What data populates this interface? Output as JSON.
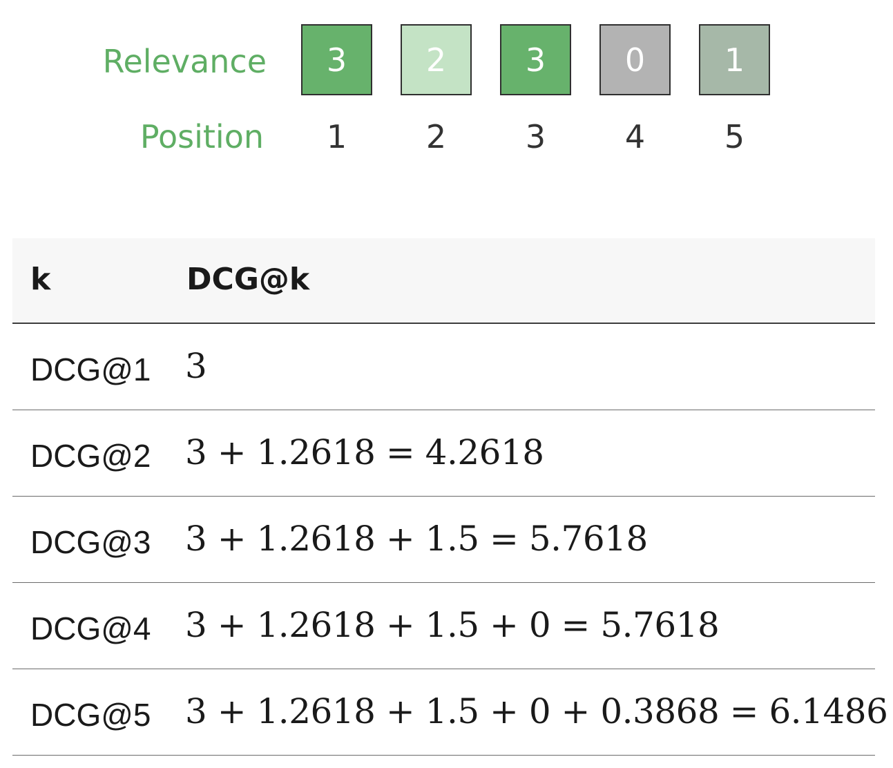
{
  "diagram": {
    "relevance_label": "Relevance",
    "position_label": "Position",
    "items": [
      {
        "relevance": "3",
        "position": "1",
        "color": "#67b26c"
      },
      {
        "relevance": "2",
        "position": "2",
        "color": "#c4e3c5"
      },
      {
        "relevance": "3",
        "position": "3",
        "color": "#67b26c"
      },
      {
        "relevance": "0",
        "position": "4",
        "color": "#b3b3b3"
      },
      {
        "relevance": "1",
        "position": "5",
        "color": "#a6b8a8"
      }
    ]
  },
  "table": {
    "headers": {
      "k": "k",
      "dcg": "DCG@k"
    },
    "rows": [
      {
        "k": "DCG@1",
        "formula": "3"
      },
      {
        "k": "DCG@2",
        "formula": "3 + 1.2618 = 4.2618"
      },
      {
        "k": "DCG@3",
        "formula": "3 + 1.2618 + 1.5 = 5.7618"
      },
      {
        "k": "DCG@4",
        "formula": "3 + 1.2618 + 1.5 + 0 = 5.7618"
      },
      {
        "k": "DCG@5",
        "formula": "3 + 1.2618 + 1.5 + 0 + 0.3868 = 6.1486"
      }
    ]
  }
}
